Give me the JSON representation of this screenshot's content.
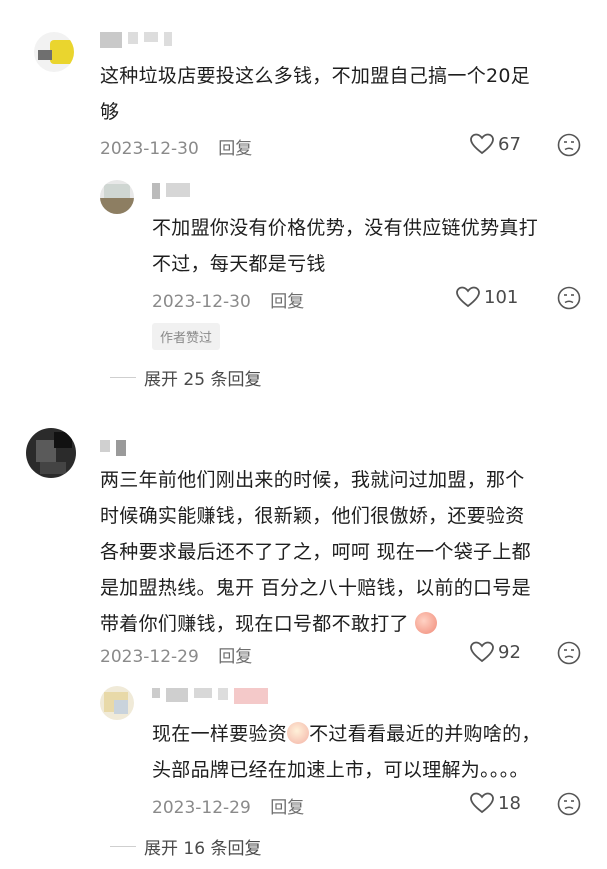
{
  "comments": [
    {
      "text_lines": [
        "这种垃圾店要投这么多钱，不加盟自己搞一个20足",
        "够"
      ],
      "date": "2023-12-30",
      "reply_label": "回复",
      "likes": "67",
      "replies": [
        {
          "text_lines": [
            "不加盟你没有价格优势，没有供应链优势真打",
            "不过，每天都是亏钱"
          ],
          "date": "2023-12-30",
          "reply_label": "回复",
          "likes": "101",
          "badge": "作者赞过"
        }
      ],
      "expand_label": "展开 25 条回复"
    },
    {
      "text_lines": [
        "两三年前他们刚出来的时候，我就问过加盟，那个",
        "时候确实能赚钱，很新颖，他们很傲娇，还要验资",
        "各种要求最后还不了了之，呵呵 现在一个袋子上都",
        "是加盟热线。鬼开 百分之八十赔钱，以前的口号是",
        "带着你们赚钱，现在口号都不敢打了"
      ],
      "date": "2023-12-29",
      "reply_label": "回复",
      "likes": "92",
      "replies": [
        {
          "text_lines": [
            "现在一样要验资",
            "不过看看最近的并购啥的，",
            "头部品牌已经在加速上市，可以理解为。。。。"
          ],
          "date": "2023-12-29",
          "reply_label": "回复",
          "likes": "18"
        }
      ],
      "expand_label": "展开 16 条回复"
    }
  ],
  "icons": {
    "like": "heart-outline-icon",
    "dislike": "frown-face-icon",
    "emoji_1": "peach-emoji",
    "emoji_2": "crying-face-emoji"
  },
  "colors": {
    "meta": "#8a8a8a",
    "text": "#1e1e1e",
    "badge_bg": "#f1f1f1"
  }
}
